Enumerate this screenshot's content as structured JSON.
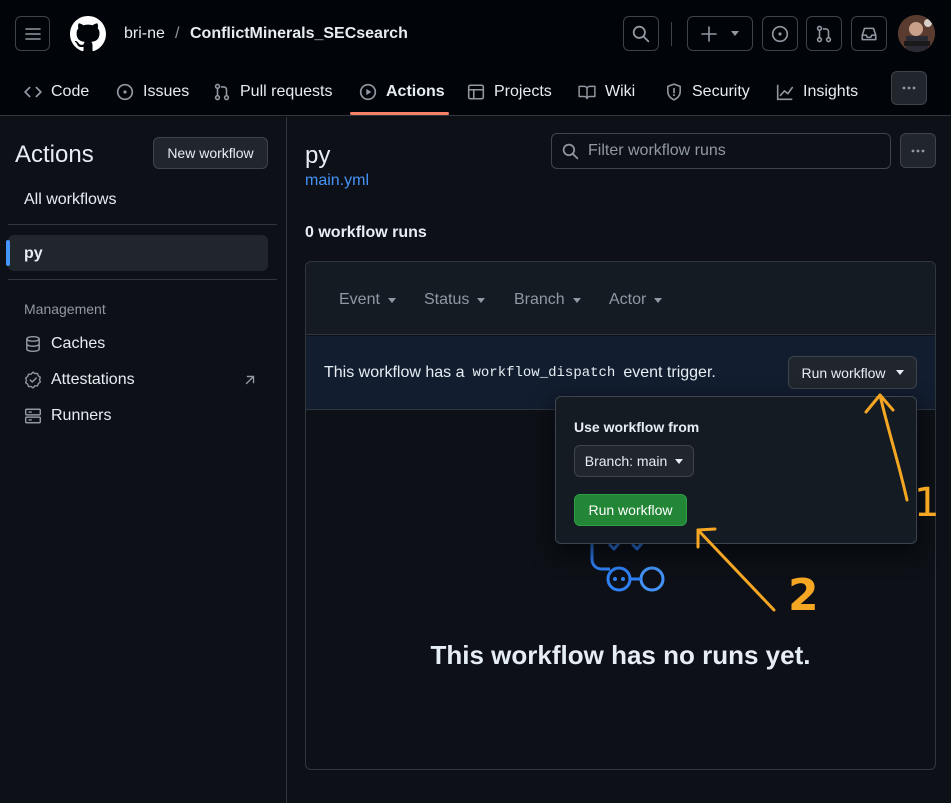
{
  "header": {
    "owner": "bri-ne",
    "separator": "/",
    "repo": "ConflictMinerals_SECsearch"
  },
  "tabs": [
    {
      "label": "Code",
      "icon": "code-icon"
    },
    {
      "label": "Issues",
      "icon": "issue-icon"
    },
    {
      "label": "Pull requests",
      "icon": "pull-request-icon"
    },
    {
      "label": "Actions",
      "icon": "play-icon",
      "active": true
    },
    {
      "label": "Projects",
      "icon": "table-icon"
    },
    {
      "label": "Wiki",
      "icon": "book-icon"
    },
    {
      "label": "Security",
      "icon": "shield-icon"
    },
    {
      "label": "Insights",
      "icon": "graph-icon"
    }
  ],
  "sidebar": {
    "title": "Actions",
    "new_workflow": "New workflow",
    "all_workflows": "All workflows",
    "selected_workflow": "py",
    "section_heading": "Management",
    "management": [
      {
        "label": "Caches",
        "icon": "database-icon"
      },
      {
        "label": "Attestations",
        "icon": "verified-icon"
      },
      {
        "label": "Runners",
        "icon": "server-icon"
      }
    ]
  },
  "main": {
    "title": "py",
    "file": "main.yml",
    "filter_placeholder": "Filter workflow runs",
    "runs_count": "0 workflow runs",
    "filters": [
      "Event",
      "Status",
      "Branch",
      "Actor"
    ],
    "dispatch_prefix": "This workflow has a",
    "dispatch_code": "workflow_dispatch",
    "dispatch_suffix": "event trigger.",
    "run_workflow_button": "Run workflow",
    "empty_message": "This workflow has no runs yet."
  },
  "popover": {
    "label": "Use workflow from",
    "branch_button": "Branch: main",
    "run_button": "Run workflow"
  },
  "annotations": {
    "num1": "1",
    "num2": "2"
  },
  "colors": {
    "background": "#0d1117",
    "accent_blue": "#4493f8",
    "active_tab_underline": "#f78166",
    "run_button_green": "#238636",
    "annotation_orange": "#f5a623"
  }
}
